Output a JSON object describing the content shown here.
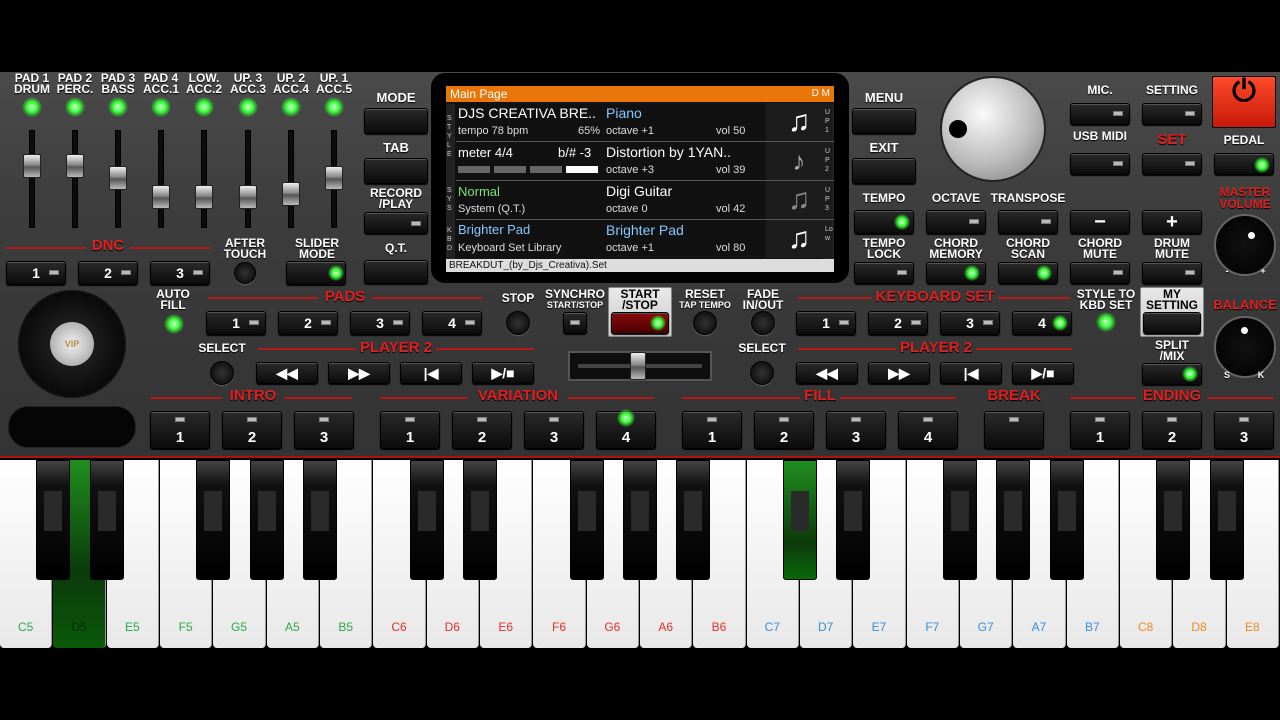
{
  "mixer": {
    "channels": [
      {
        "line1": "PAD 1",
        "line2": "DRUM",
        "level": 0.78
      },
      {
        "line1": "PAD 2",
        "line2": "PERC.",
        "level": 0.78
      },
      {
        "line1": "PAD 3",
        "line2": "BASS",
        "level": 0.62
      },
      {
        "line1": "PAD 4",
        "line2": "ACC.1",
        "level": 0.36
      },
      {
        "line1": "LOW.",
        "line2": "ACC.2",
        "level": 0.36
      },
      {
        "line1": "UP. 3",
        "line2": "ACC.3",
        "level": 0.36
      },
      {
        "line1": "UP. 2",
        "line2": "ACC.4",
        "level": 0.4
      },
      {
        "line1": "UP. 1",
        "line2": "ACC.5",
        "level": 0.62
      }
    ]
  },
  "left": {
    "mode": "MODE",
    "tab": "TAB",
    "record_play": "RECORD /PLAY",
    "qt": "Q.T.",
    "dnc": "DNC",
    "dnc_buttons": [
      "1",
      "2",
      "3"
    ],
    "after_touch": "AFTER TOUCH",
    "slider_mode": "SLIDER MODE",
    "auto_fill": "AUTO FILL",
    "jog_logo": "VIP"
  },
  "screen": {
    "title": "Main Page",
    "flags": "D M",
    "side_style": "STYLE",
    "side_sys": "SYS",
    "side_kbd": "KBD",
    "side_right": [
      "UP1",
      "UP2",
      "UP3",
      "Low"
    ],
    "style_name": "DJS CREATIVA BRE..",
    "tempo": "tempo 78 bpm",
    "volume_pct": "65%",
    "meter": "meter 4/4",
    "key": "b/# -3",
    "system_name": "Normal",
    "system_sub": "System (Q.T.)",
    "kbd_name": "Brighter Pad",
    "kbd_sub": "Keyboard Set Library",
    "parts": [
      {
        "name": "Piano",
        "octave": "octave +1",
        "vol": "vol 50",
        "icon": "music-note-icon"
      },
      {
        "name": "Distortion by 1YAN..",
        "octave": "octave +3",
        "vol": "vol 39",
        "icon": "guitar-icon"
      },
      {
        "name": "Digi Guitar",
        "octave": "octave  0",
        "vol": "vol 42",
        "icon": "music-note-icon"
      },
      {
        "name": "Brighter Pad",
        "octave": "octave +1",
        "vol": "vol 80",
        "icon": "music-note-icon"
      }
    ],
    "footer": "BREAKDUT_(by_Djs_Creativa).Set",
    "colors": {
      "header": "#e8760a",
      "highlight": "#86c8ff",
      "green": "#7de07d"
    }
  },
  "center": {
    "pads": "PADS",
    "pad_buttons": [
      "1",
      "2",
      "3",
      "4"
    ],
    "stop": "STOP",
    "synchro": "SYNCHRO",
    "synchro_sub": "START/STOP",
    "start_stop": "START /STOP",
    "reset": "RESET",
    "reset_sub": "TAP TEMPO",
    "fade": "FADE IN/OUT",
    "select": "SELECT",
    "player2": "PLAYER 2",
    "transport": [
      "rewind",
      "fast-forward",
      "to-start",
      "play-stop"
    ]
  },
  "right": {
    "menu": "MENU",
    "exit": "EXIT",
    "mic": "MIC.",
    "setting": "SETTING",
    "usb_midi": "USB MIDI",
    "set": "SET",
    "pedal": "PEDAL",
    "master_volume": "MASTER VOLUME",
    "balance": "BALANCE",
    "balance_left": "S",
    "balance_right": "K",
    "vol_min": "-",
    "vol_max": "+",
    "tempo": "TEMPO",
    "octave": "OCTAVE",
    "transpose": "TRANSPOSE",
    "minus": "−",
    "plus": "+",
    "tempo_lock": "TEMPO LOCK",
    "chord_memory": "CHORD MEMORY",
    "chord_scan": "CHORD SCAN",
    "chord_mute": "CHORD MUTE",
    "drum_mute": "DRUM MUTE",
    "keyboard_set": "KEYBOARD SET",
    "kbd_buttons": [
      "1",
      "2",
      "3",
      "4"
    ],
    "style_to_kbd": "STYLE TO KBD SET",
    "my_setting": "MY SETTING",
    "split_mix": "SPLIT /MIX"
  },
  "arranger": {
    "intro": "INTRO",
    "intro_buttons": [
      "1",
      "2",
      "3"
    ],
    "variation": "VARIATION",
    "variation_buttons": [
      "1",
      "2",
      "3",
      "4"
    ],
    "fill": "FILL",
    "fill_buttons": [
      "1",
      "2",
      "3",
      "4"
    ],
    "break": "BREAK",
    "ending": "ENDING",
    "ending_buttons": [
      "1",
      "2",
      "3"
    ]
  },
  "keyboard": {
    "white_keys": [
      "C5",
      "D5",
      "E5",
      "F5",
      "G5",
      "A5",
      "B5",
      "C6",
      "D6",
      "E6",
      "F6",
      "G6",
      "A6",
      "B6",
      "C7",
      "D7",
      "E7",
      "F7",
      "G7",
      "A7",
      "B7",
      "C8",
      "D8",
      "E8"
    ],
    "pressed": [
      "D5",
      "C#7"
    ],
    "octave_colors": {
      "5": "#2aa84a",
      "6": "#e03030",
      "7": "#3a8fd8",
      "8": "#f08a20"
    }
  }
}
